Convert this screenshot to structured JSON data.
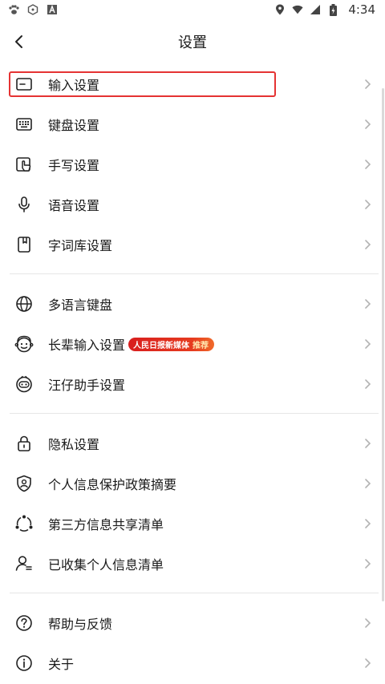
{
  "statusbar": {
    "time": "4:34"
  },
  "header": {
    "title": "设置"
  },
  "sections": [
    {
      "items": [
        {
          "label": "输入设置"
        },
        {
          "label": "键盘设置"
        },
        {
          "label": "手写设置"
        },
        {
          "label": "语音设置"
        },
        {
          "label": "字词库设置"
        }
      ]
    },
    {
      "items": [
        {
          "label": "多语言键盘"
        },
        {
          "label": "长辈输入设置",
          "badge": "人民日报新媒体",
          "badge_sub": "推荐"
        },
        {
          "label": "汪仔助手设置"
        }
      ]
    },
    {
      "items": [
        {
          "label": "隐私设置"
        },
        {
          "label": "个人信息保护政策摘要"
        },
        {
          "label": "第三方信息共享清单"
        },
        {
          "label": "已收集个人信息清单"
        }
      ]
    },
    {
      "items": [
        {
          "label": "帮助与反馈"
        },
        {
          "label": "关于"
        }
      ]
    }
  ],
  "colors": {
    "highlight_border": "#e53333",
    "badge_bg": "#d81e1e",
    "text_primary": "#1a1a1a",
    "chevron": "#b3b3b3"
  },
  "icons": {
    "status_left": [
      "paw-icon",
      "hexagon-icon",
      "font-a-icon"
    ],
    "status_right": [
      "location-icon",
      "wifi-icon",
      "signal-icon",
      "battery-icon"
    ]
  }
}
